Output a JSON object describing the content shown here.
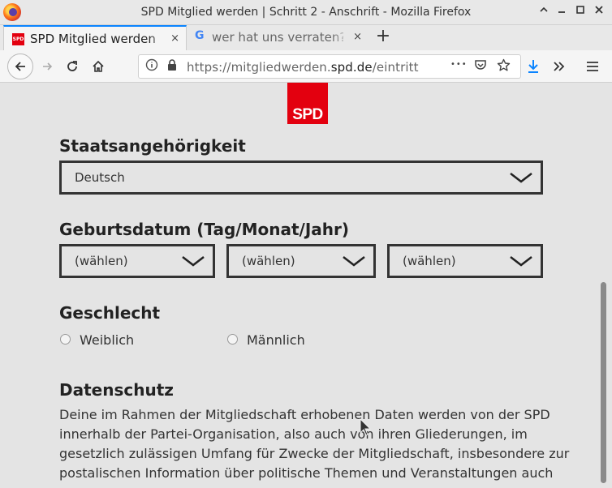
{
  "window": {
    "title": "SPD Mitglied werden | Schritt 2 - Anschrift - Mozilla Firefox",
    "minimize_icon": "chevron-up",
    "controls": [
      "minimize-icon",
      "restore-icon",
      "maximize-icon",
      "close-icon"
    ]
  },
  "tabs": [
    {
      "label": "SPD Mitglied werden | Schritt 2 - Anschrift",
      "favicon": "spd-favicon",
      "active": true
    },
    {
      "label": "wer hat uns verraten? - Google Suche",
      "favicon": "google-g-icon",
      "active": false
    }
  ],
  "tab_close_glyph": "×",
  "new_tab_glyph": "+",
  "favicon_spd_text": "SPD",
  "favicon_g_text": "G",
  "nav": {
    "url_prefix": "https://mitgliedwerden.",
    "url_host": "spd.de",
    "url_suffix": "/eintritt",
    "more_glyph": "•••",
    "icons": [
      "back-icon",
      "forward-icon",
      "reload-icon",
      "home-icon",
      "info-icon",
      "lock-icon",
      "page-actions-icon",
      "pocket-icon",
      "bookmark-star-icon",
      "download-icon",
      "overflow-icon",
      "menu-icon"
    ]
  },
  "page": {
    "logo_text": "SPD",
    "nationality": {
      "label": "Staatsangehörigkeit",
      "value": "Deutsch"
    },
    "birthdate": {
      "label": "Geburtsdatum (Tag/Monat/Jahr)",
      "day": "(wählen)",
      "month": "(wählen)",
      "year": "(wählen)"
    },
    "gender": {
      "label": "Geschlecht",
      "options": [
        "Weiblich",
        "Männlich"
      ]
    },
    "privacy": {
      "heading": "Datenschutz",
      "text": "Deine im Rahmen der Mitgliedschaft erhobenen Daten werden von der SPD innerhalb der Partei-Organisation, also auch von ihren Gliederungen, im gesetzlich zulässigen Umfang für Zwecke der Mitgliedschaft, insbesondere zur postalischen Information über politische Themen und Veranstaltungen auch"
    }
  },
  "colors": {
    "accent": "#0a84ff",
    "spd_red": "#e3000f",
    "page_bg": "#e4e4e4"
  }
}
